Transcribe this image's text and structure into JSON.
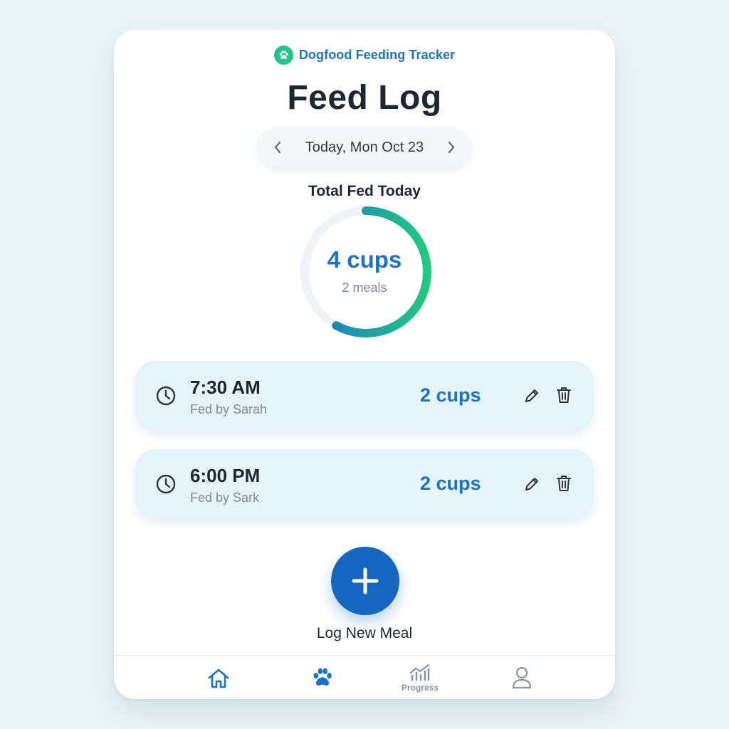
{
  "app": {
    "name": "Dogfood Feeding Tracker",
    "brand_icon": "paw-icon"
  },
  "page": {
    "title": "Feed Log"
  },
  "date_nav": {
    "label": "Today, Mon Oct 23",
    "prev_icon": "chevron-left-icon",
    "next_icon": "chevron-right-icon"
  },
  "summary": {
    "label": "Total Fed Today",
    "value": "4 cups",
    "meals": "2 meals",
    "progress_fraction": 0.58,
    "gradient": [
      "#1a73c8",
      "#22c97f"
    ]
  },
  "entries": [
    {
      "time": "7:30 AM",
      "fed_by": "Fed by Sarah",
      "amount": "2 cups"
    },
    {
      "time": "6:00 PM",
      "fed_by": "Fed by Sark",
      "amount": "2 cups"
    }
  ],
  "fab": {
    "label": "Log New Meal",
    "icon": "plus-icon"
  },
  "nav": {
    "items": [
      {
        "icon": "home-icon",
        "label": ""
      },
      {
        "icon": "paw-icon",
        "label": ""
      },
      {
        "icon": "chart-icon",
        "label": "Progress"
      },
      {
        "icon": "user-icon",
        "label": ""
      }
    ]
  },
  "colors": {
    "accent": "#1a73c8",
    "green": "#22c48a",
    "entry_bg": "#e5f3fb",
    "page_bg": "#eaf4f6"
  }
}
